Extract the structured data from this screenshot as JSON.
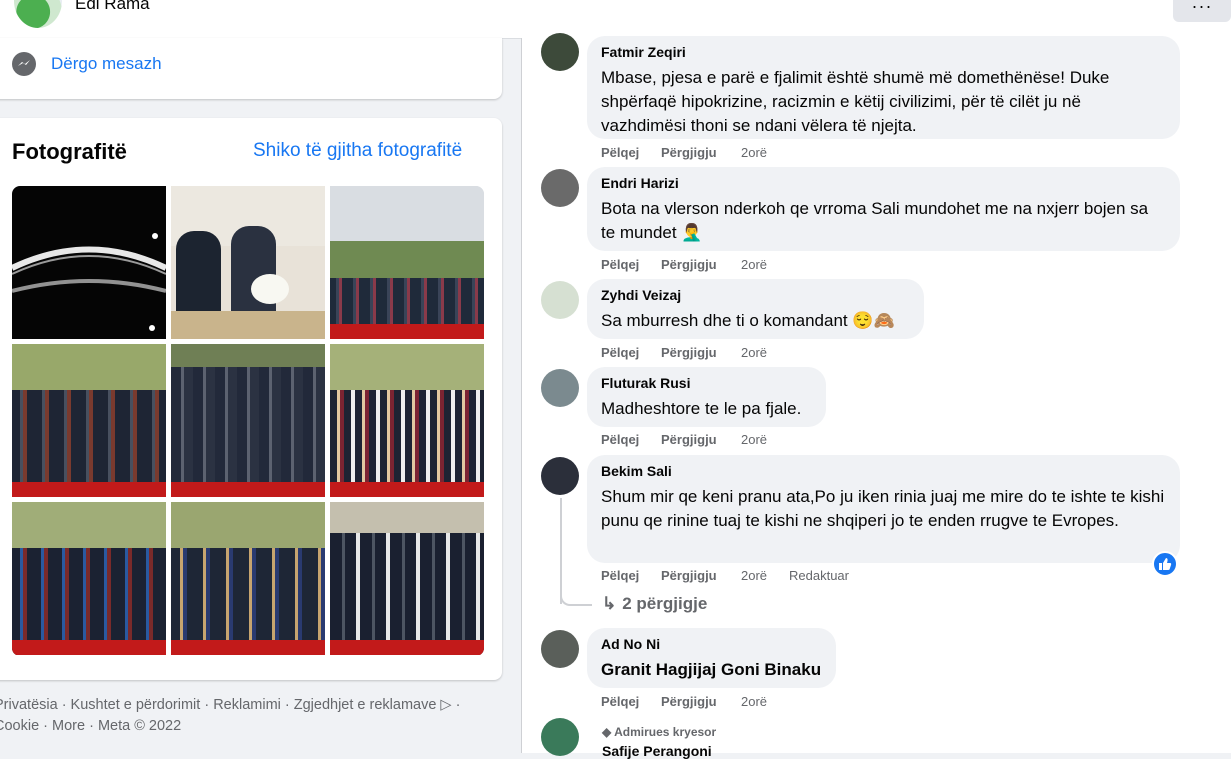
{
  "profile": {
    "name": "Edi Rama",
    "more_label": "···"
  },
  "message_button": {
    "label": "Dërgo mesazh"
  },
  "photos": {
    "title": "Fotografitë",
    "see_all": "Shiko të gjitha fotografitë"
  },
  "footer": {
    "line1": "Privatësia · Kushtet e përdorimit · Reklamimi · Zgjedhjet e reklamave ▷ ·",
    "line2": "Cookie · More · Meta © 2022"
  },
  "comment_actions": {
    "like": "Pëlqej",
    "reply": "Përgjigju",
    "time": "2orë",
    "edited": "Redaktuar"
  },
  "comments": [
    {
      "name": "Fatmir Zeqiri",
      "text": "Mbase, pjesa e parë e fjalimit është shumë më domethënëse! Duke shpërfaqë hipokrizine, racizmin e këtij civilizimi, për të cilët ju në vazhdimësi thoni se ndani vëlera të njejta."
    },
    {
      "name": "Endri Harizi",
      "text": "Bota na vlerson nderkoh qe vrroma Sali mundohet me na nxjerr bojen sa te mundet 🤦‍♂️"
    },
    {
      "name": "Zyhdi Veizaj",
      "text": "Sa mburresh dhe ti o komandant 😌🙈"
    },
    {
      "name": "Fluturak Rusi",
      "text": "Madheshtore te le pa fjale."
    },
    {
      "name": "Bekim Sali",
      "text": "Shum mir qe keni pranu ata,Po ju iken rinia juaj me mire do te ishte te kishi punu qe rinine tuaj te kishi ne shqiperi jo te enden rrugve te Evropes."
    },
    {
      "name": "Ad No Ni",
      "text": "Granit Hagjijaj Goni Binaku"
    }
  ],
  "replies_link": "2 përgjigje",
  "top_fan": {
    "badge": "Admirues kryesor",
    "name": "Safije Perangoni"
  },
  "colors": {
    "accent": "#1877f2",
    "bubble": "#f0f2f5",
    "muted": "#65676b"
  }
}
